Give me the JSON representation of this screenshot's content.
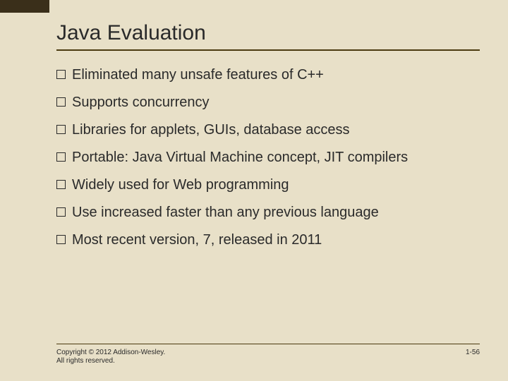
{
  "slide": {
    "title": "Java Evaluation",
    "bullets": [
      "Eliminated many unsafe features of C++",
      "Supports concurrency",
      "Libraries for applets, GUIs, database access",
      "Portable: Java Virtual Machine concept, JIT compilers",
      "Widely used for Web programming",
      "Use increased faster than any previous language",
      "Most recent version, 7, released in 2011"
    ],
    "copyright": "Copyright © 2012 Addison-Wesley. All rights reserved.",
    "page_number": "1-56"
  }
}
